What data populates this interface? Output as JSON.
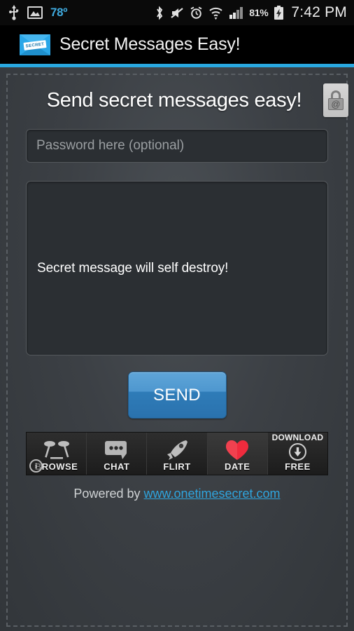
{
  "statusbar": {
    "icons_left": [
      "usb-icon",
      "gallery-image-icon"
    ],
    "temperature": "78º",
    "icons_right": [
      "bluetooth-icon",
      "mute-vibrate-icon",
      "alarm-clock-icon",
      "wifi-icon",
      "cellular-signal-icon"
    ],
    "battery_percent": "81%",
    "battery_state": "charging",
    "time": "7:42 PM"
  },
  "titlebar": {
    "app_icon": "secret-envelope-icon",
    "stamp_text": "SECRET",
    "title": "Secret Messages Easy!",
    "accent_color": "#29a8e0"
  },
  "main": {
    "headline": "Send secret messages easy!",
    "lock_button": {
      "icon": "padlock-at-icon",
      "symbol": "@"
    },
    "password": {
      "value": "",
      "placeholder": "Password here (optional)"
    },
    "message": {
      "value": "Secret message will self destroy!",
      "placeholder": ""
    },
    "send_label": "SEND"
  },
  "ad": {
    "info_badge": "i",
    "cells": [
      {
        "label": "BROWSE",
        "icon": "cocktail-glasses-icon",
        "highlighted": false
      },
      {
        "label": "CHAT",
        "icon": "speech-bubble-icon",
        "highlighted": false
      },
      {
        "label": "FLIRT",
        "icon": "rocket-icon",
        "highlighted": false
      },
      {
        "label": "DATE",
        "icon": "heart-icon",
        "highlighted": true
      }
    ],
    "download": {
      "top_label": "DOWNLOAD",
      "bottom_label": "FREE",
      "icon": "download-arrow-icon"
    }
  },
  "footer": {
    "prefix": "Powered by ",
    "link_text": "www.onetimesecret.com",
    "link_color": "#2fa4dd"
  }
}
